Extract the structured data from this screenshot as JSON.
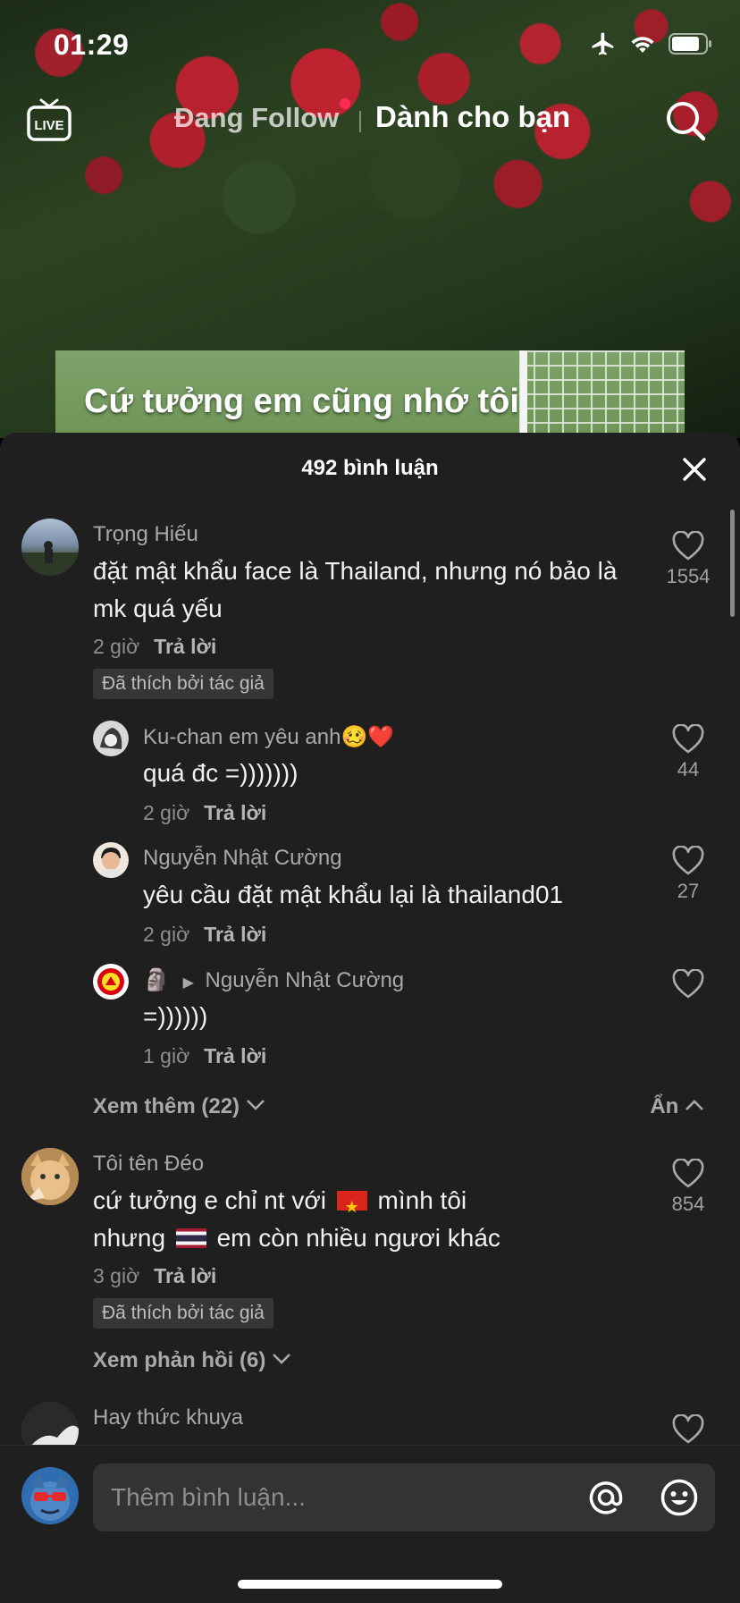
{
  "status": {
    "time": "01:29"
  },
  "nav": {
    "live_label": "LIVE",
    "following": "Đang Follow",
    "for_you": "Dành cho bạn"
  },
  "video": {
    "caption": "Cứ tưởng em cũng nhớ tôi"
  },
  "comments_sheet": {
    "title": "492 bình luận",
    "reply_label": "Trả lời",
    "liked_by_author": "Đã thích bởi tác giả",
    "comments": [
      {
        "author": "Trọng Hiếu",
        "text": "đặt mật khẩu face là Thailand, nhưng nó bảo là mk quá yếu",
        "time": "2 giờ",
        "likes": "1554",
        "replies": [
          {
            "author": "Ku-chan em yêu anh🥴❤️",
            "text": "quá đc =)))))))",
            "time": "2 giờ",
            "likes": "44"
          },
          {
            "author": "Nguyễn Nhật Cường",
            "text": "yêu cầu đặt mật khẩu lại là thailand01",
            "time": "2 giờ",
            "likes": "27"
          },
          {
            "author_emoji": "🗿",
            "reply_to": "Nguyễn Nhật Cường",
            "text": "=))))))",
            "time": "1 giờ"
          }
        ],
        "view_more": "Xem thêm (22)",
        "hide": "Ẩn"
      },
      {
        "author": "Tôi tên Đéo",
        "text_line1_a": "cứ tưởng e chỉ nt với",
        "text_line1_b": "mình tôi",
        "text_line2_a": "nhưng",
        "text_line2_b": "em còn nhiều ngươi khác",
        "time": "3 giờ",
        "likes": "854",
        "view_replies": "Xem phản hồi (6)"
      },
      {
        "author": "Hay thức khuya"
      }
    ]
  },
  "input": {
    "placeholder": "Thêm bình luận..."
  },
  "colors": {
    "accent": "#fe2c55",
    "sheet_bg": "#1f1f1f",
    "input_bg": "#333333"
  }
}
